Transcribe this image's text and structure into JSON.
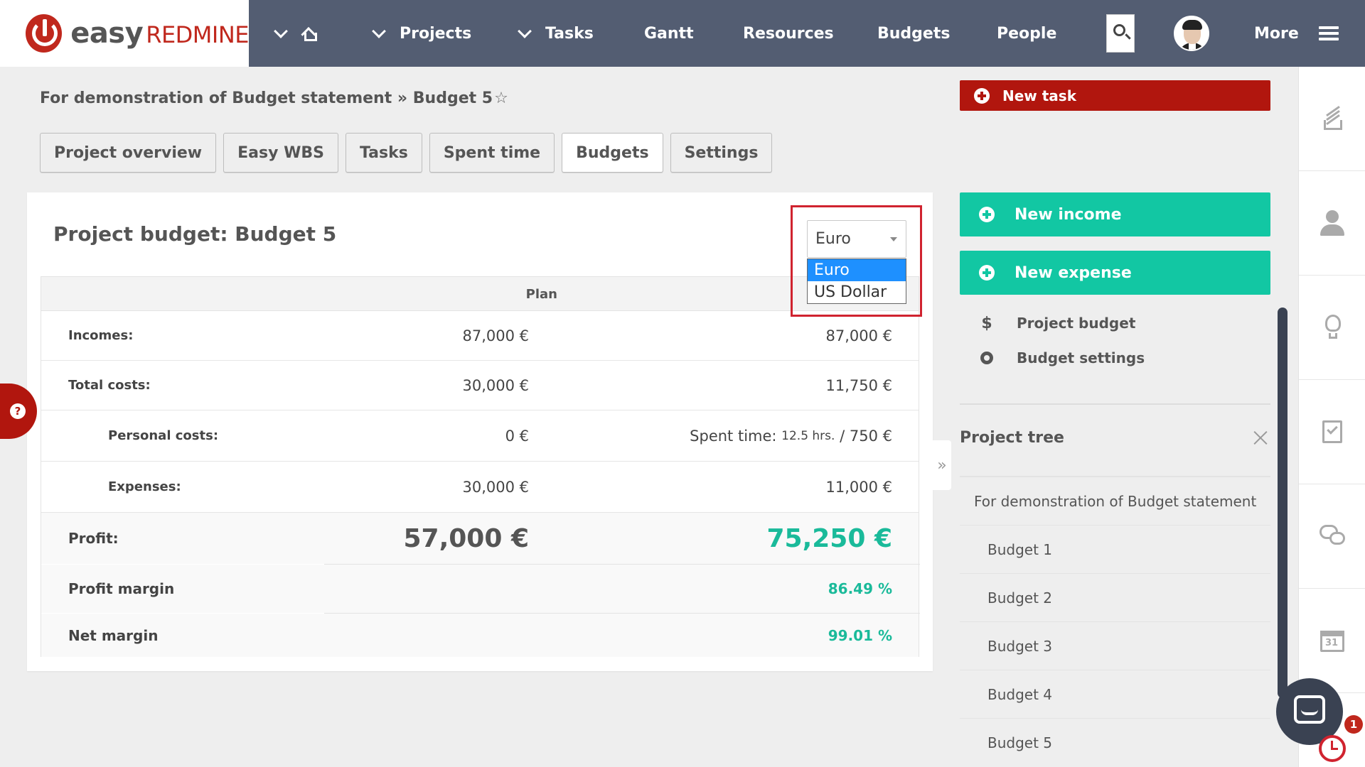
{
  "logo": {
    "easy": "easy",
    "redmine": "REDMINE"
  },
  "topnav": {
    "items": [
      {
        "label": "Projects"
      },
      {
        "label": "Tasks"
      },
      {
        "label": "Gantt"
      },
      {
        "label": "Resources"
      },
      {
        "label": "Budgets"
      },
      {
        "label": "People"
      }
    ],
    "more_label": "More"
  },
  "breadcrumb": {
    "project": "For demonstration of Budget statement",
    "separator": "»",
    "page": "Budget 5",
    "star": "☆"
  },
  "tabs": [
    {
      "label": "Project overview"
    },
    {
      "label": "Easy WBS"
    },
    {
      "label": "Tasks"
    },
    {
      "label": "Spent time"
    },
    {
      "label": "Budgets",
      "active": true
    },
    {
      "label": "Settings"
    }
  ],
  "budget": {
    "title": "Project budget: Budget 5",
    "plan_header": "Plan",
    "currency": {
      "selected": "Euro",
      "options": [
        "Euro",
        "US Dollar"
      ]
    },
    "rows": {
      "incomes": {
        "label": "Incomes:",
        "plan": "87,000 €",
        "real": "87,000 €"
      },
      "total_costs": {
        "label": "Total costs:",
        "plan": "30,000 €",
        "real": "11,750 €"
      },
      "personal_costs": {
        "label": "Personal costs:",
        "plan": "0 €",
        "real_prefix": "Spent time: ",
        "real_hours": "12.5 hrs.",
        "real_sep": " / ",
        "real_value": "750 €"
      },
      "expenses": {
        "label": "Expenses:",
        "plan": "30,000 €",
        "real": "11,000 €"
      },
      "profit": {
        "label": "Profit:",
        "plan": "57,000 €",
        "real": "75,250 €"
      },
      "profit_margin": {
        "label": "Profit margin",
        "real": "86.49 %"
      },
      "net_margin": {
        "label": "Net margin",
        "real": "99.01 %"
      }
    }
  },
  "sidebar": {
    "new_task": "New task",
    "new_income": "New income",
    "new_expense": "New expense",
    "links": {
      "project_budget": "Project budget",
      "budget_settings": "Budget settings",
      "dollar_symbol": "$"
    },
    "tree_title": "Project tree",
    "tree_items": [
      "For demonstration of Budget statement",
      "Budget 1",
      "Budget 2",
      "Budget 3",
      "Budget 4",
      "Budget 5"
    ],
    "collapse_symbol": "»"
  },
  "rail": {
    "calendar_day": "31"
  },
  "notifications": {
    "count": "1"
  },
  "help": {
    "symbol": "?"
  },
  "colors": {
    "nav_bg": "#535d72",
    "brand_red": "#b1160e",
    "teal": "#12c7a3",
    "positive": "#1aba9a",
    "highlight": "#d0232f"
  }
}
